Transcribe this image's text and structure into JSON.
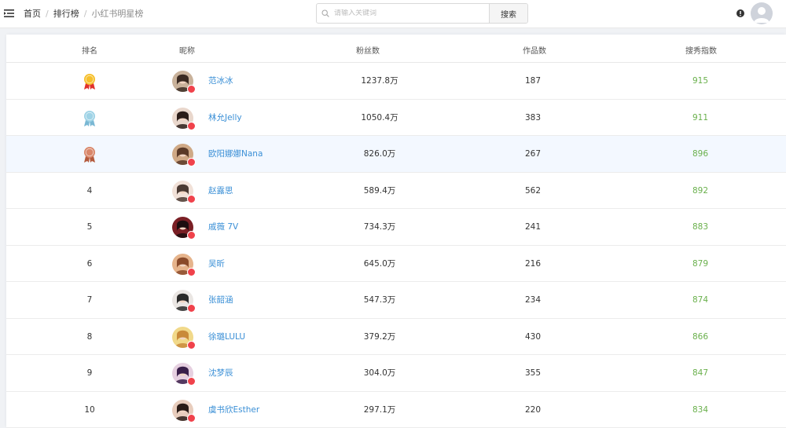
{
  "breadcrumb": {
    "items": [
      "首页",
      "排行榜",
      "小红书明星榜"
    ],
    "separator": "/"
  },
  "search": {
    "placeholder": "请输入关键词",
    "button_label": "搜索"
  },
  "icons": {
    "menu": "menu-fold-icon",
    "search": "search-icon",
    "info": "info-circle-icon",
    "user": "user-avatar-icon",
    "verified": "verified-badge-icon"
  },
  "colors": {
    "nickname": "#3a8fd6",
    "score": "#6ab04c",
    "verified_badge": "#f0424b",
    "highlight_row": "#f3f8ff"
  },
  "table": {
    "columns": [
      "排名",
      "昵称",
      "粉丝数",
      "作品数",
      "搜秀指数"
    ],
    "rows": [
      {
        "rank": "1",
        "medal": "gold",
        "nickname": "范冰冰",
        "fans": "1237.8万",
        "works": "187",
        "score": "915"
      },
      {
        "rank": "2",
        "medal": "silver",
        "nickname": "林允Jelly",
        "fans": "1050.4万",
        "works": "383",
        "score": "911"
      },
      {
        "rank": "3",
        "medal": "bronze",
        "nickname": "欧阳娜娜Nana",
        "fans": "826.0万",
        "works": "267",
        "score": "896",
        "highlight": true
      },
      {
        "rank": "4",
        "nickname": "赵露思",
        "fans": "589.4万",
        "works": "562",
        "score": "892"
      },
      {
        "rank": "5",
        "nickname": "戚薇 7V",
        "fans": "734.3万",
        "works": "241",
        "score": "883"
      },
      {
        "rank": "6",
        "nickname": "吴昕",
        "fans": "645.0万",
        "works": "216",
        "score": "879"
      },
      {
        "rank": "7",
        "nickname": "张韶涵",
        "fans": "547.3万",
        "works": "234",
        "score": "874"
      },
      {
        "rank": "8",
        "nickname": "徐璐LULU",
        "fans": "379.2万",
        "works": "430",
        "score": "866"
      },
      {
        "rank": "9",
        "nickname": "沈梦辰",
        "fans": "304.0万",
        "works": "355",
        "score": "847"
      },
      {
        "rank": "10",
        "nickname": "虞书欣Esther",
        "fans": "297.1万",
        "works": "220",
        "score": "834"
      }
    ]
  }
}
